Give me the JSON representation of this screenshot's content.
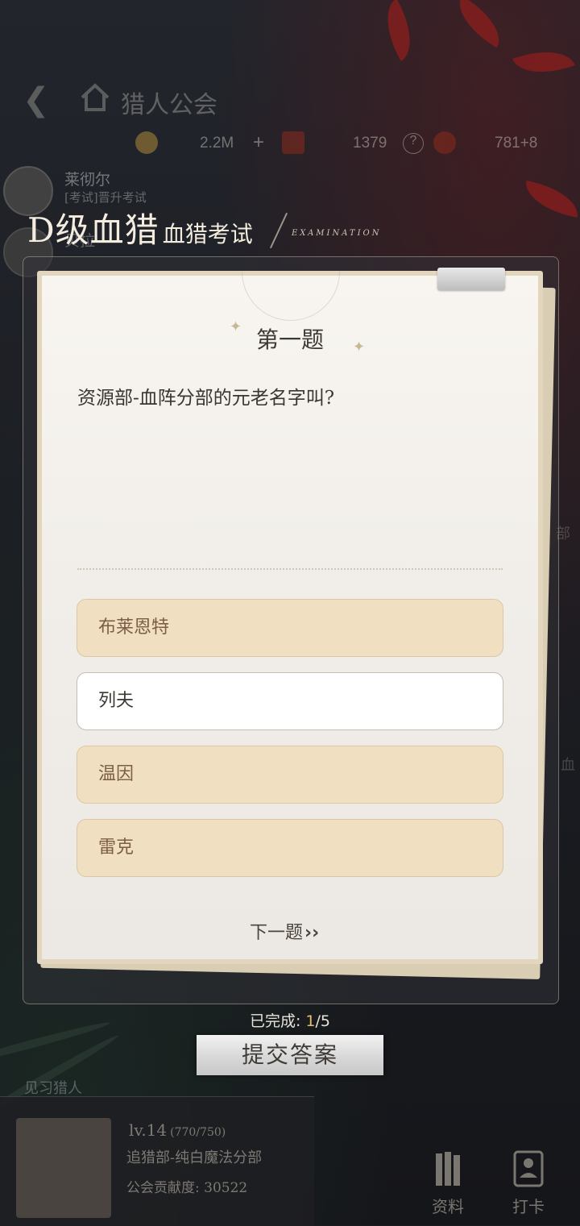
{
  "header": {
    "title": "猎人公会"
  },
  "currencies": [
    {
      "icon": "gold-coin-icon",
      "value": "2.2M"
    },
    {
      "icon": "red-gem-icon",
      "value": "1379"
    },
    {
      "icon": "emblem-icon",
      "value": "781+8"
    }
  ],
  "chat": [
    {
      "name": "莱彻尔",
      "message": "[考试]晋升考试"
    },
    {
      "name": "贝拉",
      "message": ""
    }
  ],
  "exam": {
    "rank": "D级血猎",
    "title": "血猎考试",
    "subtitle": "EXAMINATION"
  },
  "question": {
    "number_label": "第一题",
    "text": "资源部-血阵分部的元老名字叫?"
  },
  "options": [
    {
      "label": "布莱恩特",
      "selected": false
    },
    {
      "label": "列夫",
      "selected": true
    },
    {
      "label": "温因",
      "selected": false
    },
    {
      "label": "雷克",
      "selected": false
    }
  ],
  "next_label": "下一题",
  "progress": {
    "label": "已完成:",
    "current": "1",
    "total": "/5"
  },
  "submit_label": "提交答案",
  "profile": {
    "tag": "见习猎人",
    "level": "lv.14",
    "exp": "(770/750)",
    "department": "追猎部-纯白魔法分部",
    "contribution": "公会贡献度: 30522"
  },
  "nav": {
    "materials": "资料",
    "checkin": "打卡"
  },
  "side_labels": {
    "right_top": "部",
    "right_mid": "血"
  },
  "colors": {
    "option_bg": "#f1dfc2",
    "option_selected_bg": "#ffffff",
    "progress_current": "#e6bd70"
  }
}
